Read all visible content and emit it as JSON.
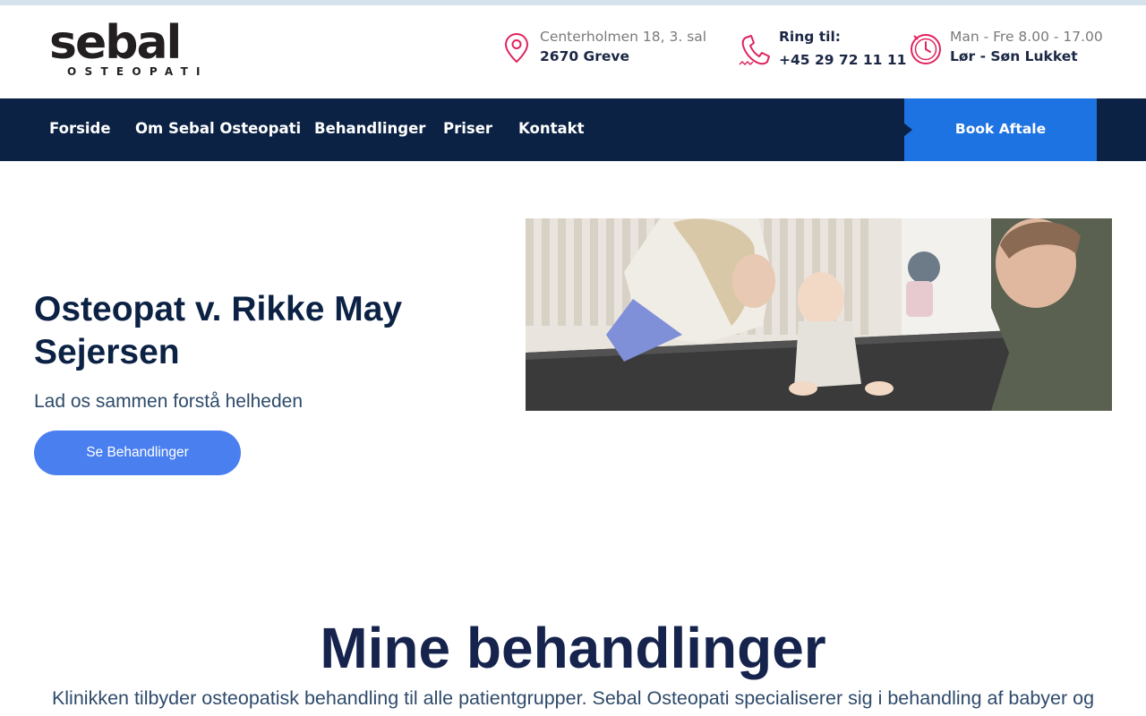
{
  "brand": {
    "logo_word": "sebal",
    "logo_sub": "OSTEOPATI"
  },
  "header": {
    "address": {
      "icon": "map-pin-icon",
      "line1": "Centerholmen 18, 3. sal",
      "line2": "2670 Greve"
    },
    "phone": {
      "icon": "phone-icon",
      "line1": "Ring til:",
      "line2": "+45 29 72 11 11"
    },
    "hours": {
      "icon": "clock-icon",
      "line1": "Man - Fre 8.00 - 17.00",
      "line2": "Lør - Søn Lukket"
    }
  },
  "nav": {
    "items": [
      {
        "label": "Forside"
      },
      {
        "label": "Om Sebal Osteopati"
      },
      {
        "label": "Behandlinger"
      },
      {
        "label": "Priser"
      },
      {
        "label": "Kontakt"
      }
    ],
    "cta_label": "Book Aftale"
  },
  "hero": {
    "title": "Osteopat v. Rikke May Sejersen",
    "subtitle": "Lad os sammen forstå helheden",
    "button_label": "Se Behandlinger"
  },
  "treatments": {
    "title": "Mine behandlinger",
    "intro": "Klinikken tilbyder osteopatisk behandling til alle patientgrupper. Sebal Osteopati specialiserer sig i behandling af babyer og"
  },
  "colors": {
    "navy": "#0c2245",
    "accent_blue": "#1e73e2",
    "button_blue": "#4a7ff0",
    "icon_pink": "#e0245e"
  }
}
